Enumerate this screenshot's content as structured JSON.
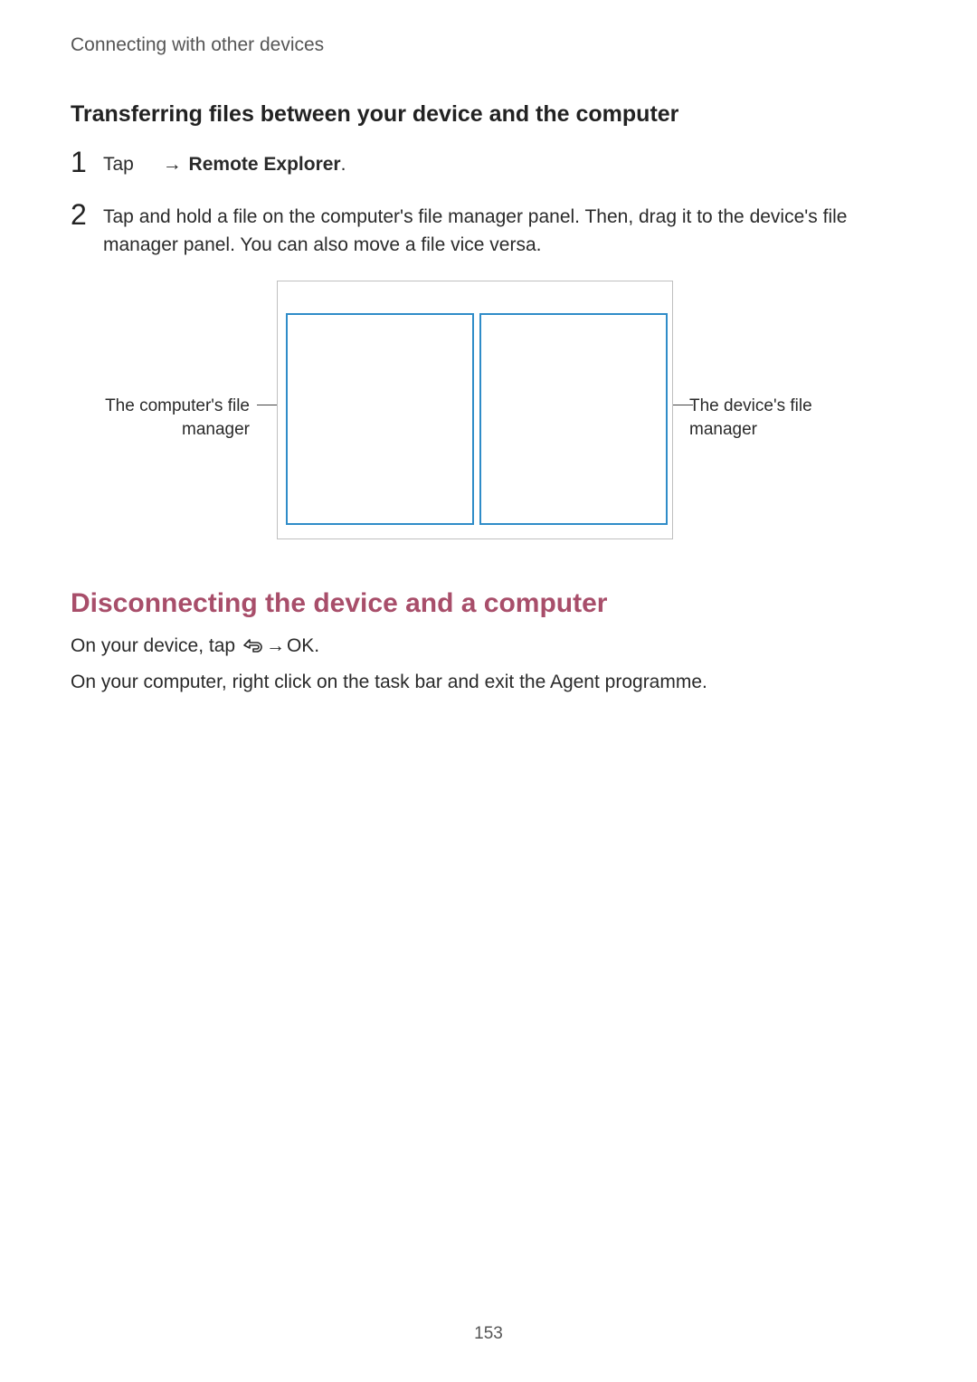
{
  "chapter": "Connecting with other devices",
  "subhead": "Transferring files between your device and the computer",
  "steps": [
    {
      "num": "1",
      "pre": "Tap",
      "arrow": "→",
      "bold": "Remote Explorer",
      "post": "."
    },
    {
      "num": "2",
      "text": "Tap and hold a file on the computer's file manager panel. Then, drag it to the device's file manager panel. You can also move a file vice versa."
    }
  ],
  "diagram": {
    "left_label": "The computer's file manager",
    "right_label": "The device's file manager"
  },
  "h2": "Disconnecting the device and a computer",
  "para1": {
    "pre": "On your device, tap ",
    "arrow": " → ",
    "bold": "OK",
    "post": "."
  },
  "para2": {
    "pre": "On your computer, right click ",
    "post": " on the task bar and exit the Agent programme."
  },
  "page_number": "153"
}
